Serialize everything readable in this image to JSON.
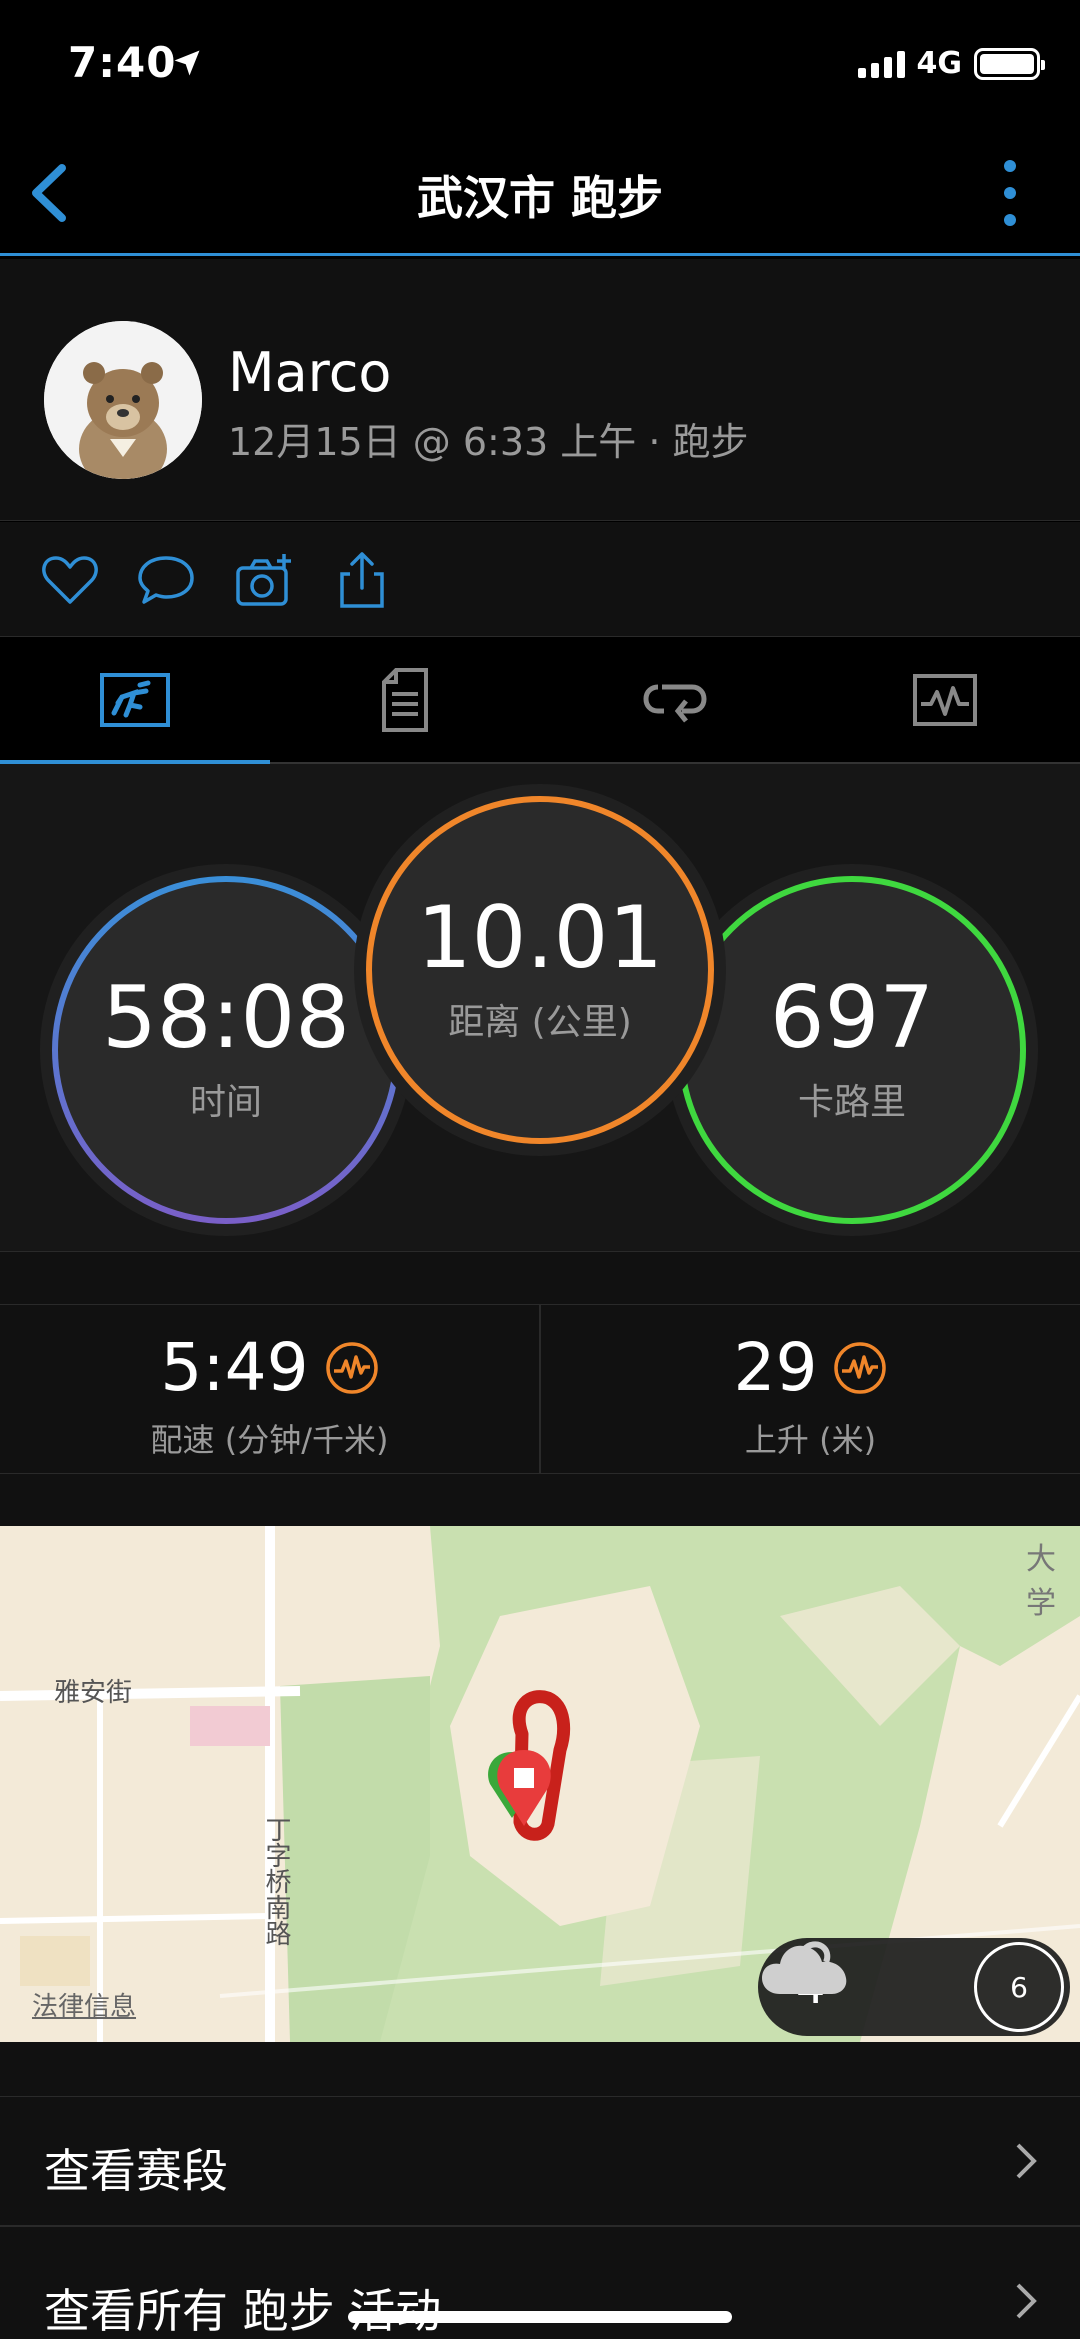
{
  "status_bar": {
    "time": "7:40",
    "network": "4G"
  },
  "nav": {
    "title": "武汉市 跑步"
  },
  "profile": {
    "name": "Marco",
    "meta": "12月15日 @ 6:33 上午 · 跑步"
  },
  "tabs": [
    {
      "name": "summary",
      "icon": "run-icon",
      "active": true
    },
    {
      "name": "details",
      "icon": "document-icon",
      "active": false
    },
    {
      "name": "laps",
      "icon": "repeat-icon",
      "active": false
    },
    {
      "name": "charts",
      "icon": "chart-icon",
      "active": false
    }
  ],
  "stats": {
    "time": {
      "value": "58:08",
      "label": "时间"
    },
    "distance": {
      "value": "10.01",
      "label": "距离 (公里)"
    },
    "calories": {
      "value": "697",
      "label": "卡路里"
    }
  },
  "metrics": {
    "pace": {
      "value": "5:49",
      "label": "配速 (分钟/千米)"
    },
    "ascent": {
      "value": "29",
      "label": "上升 (米)"
    }
  },
  "map": {
    "labels": {
      "street1": "雅安街",
      "street2": "丁字桥南路",
      "corner": "大学",
      "legal": "法律信息"
    },
    "weather": {
      "temp": "4°",
      "uv": "6"
    }
  },
  "list": {
    "segments": "查看赛段",
    "all_activities": "查看所有 跑步 活动"
  },
  "colors": {
    "accent": "#2f8fd6",
    "distance": "#f0862a",
    "calories": "#3fd83f",
    "time_top": "#3a8fd8",
    "time_bottom": "#7a5fc8"
  }
}
